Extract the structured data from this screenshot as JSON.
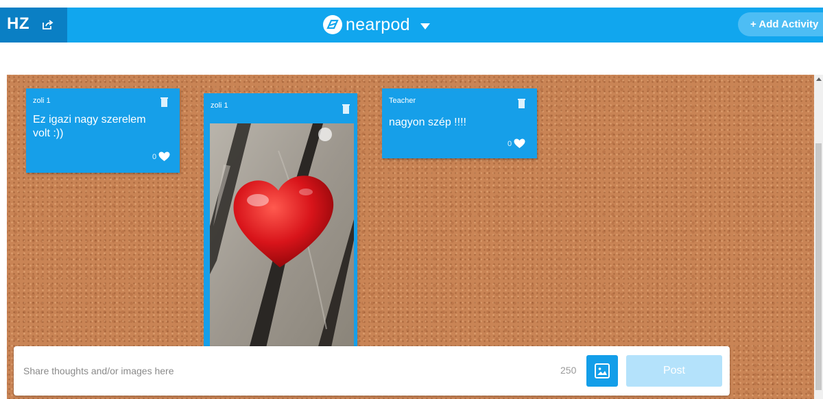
{
  "header": {
    "user_initials": "HZ",
    "brand_name": "nearpod",
    "add_activity_label": "+ Add Activity",
    "accent_color": "#11a6ee"
  },
  "board": {
    "posts": [
      {
        "author": "zoli 1",
        "text_lines": [
          "Ez igazi nagy szerelem",
          "volt :))"
        ],
        "likes": "0"
      },
      {
        "author": "zoli 1",
        "image": "red heart on wooden planks",
        "likes": ""
      },
      {
        "author": "Teacher",
        "text_lines": [
          "nagyon szép !!!!"
        ],
        "likes": "0"
      }
    ]
  },
  "composer": {
    "placeholder": "Share thoughts and/or images here",
    "char_limit": "250",
    "post_label": "Post"
  },
  "icons": [
    "share-icon",
    "nearpod-logo-icon",
    "chevron-down-icon",
    "trash-icon",
    "heart-icon",
    "image-icon"
  ]
}
